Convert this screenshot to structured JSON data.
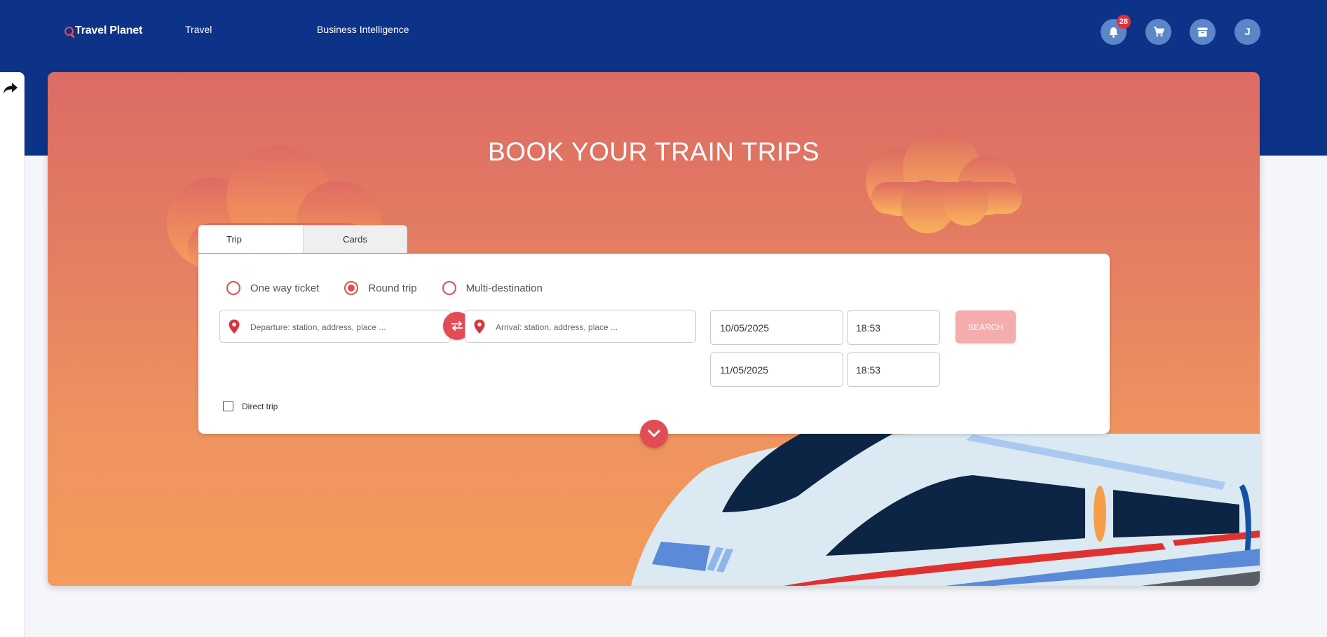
{
  "header": {
    "brand": "Travel Planet",
    "nav": [
      "Travel",
      "Business Intelligence"
    ],
    "notifications_count": "28",
    "avatar_initial": "J",
    "icons": [
      "bell-icon",
      "cart-icon",
      "archive-icon"
    ]
  },
  "hero": {
    "title": "BOOK YOUR TRAIN TRIPS"
  },
  "booking": {
    "tabs": [
      "Trip",
      "Cards"
    ],
    "active_tab": "Trip",
    "trip_types": [
      "One way ticket",
      "Round trip",
      "Multi-destination"
    ],
    "selected_trip_type": "Round trip",
    "departure_placeholder": "Departure: station, address, place ...",
    "arrival_placeholder": "Arrival: station, address, place ...",
    "outbound_date": "10/05/2025",
    "outbound_time": "18:53",
    "return_date": "11/05/2025",
    "return_time": "18:53",
    "search_label": "SEARCH",
    "direct_trip_label": "Direct trip",
    "direct_trip_checked": false
  },
  "colors": {
    "header_bg": "#0c3388",
    "accent": "#e24d55",
    "hero_top": "#dc6b64",
    "hero_bottom": "#f39c5b"
  }
}
